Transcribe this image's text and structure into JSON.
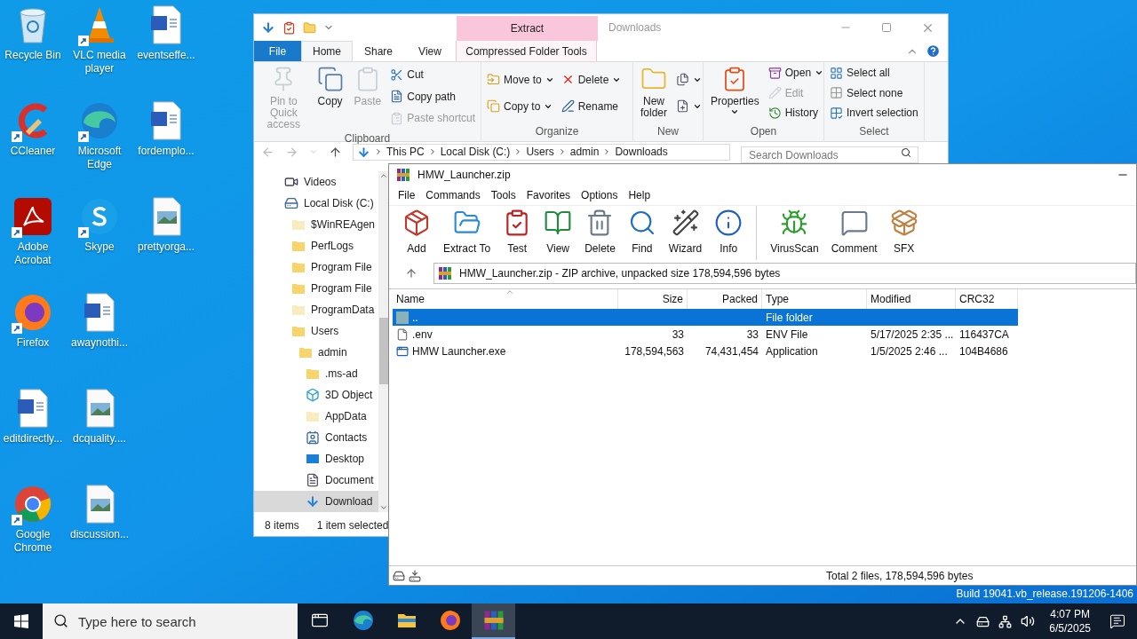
{
  "desktop_icons": [
    {
      "label": "Recycle Bin",
      "kind": "recycle",
      "shortcut": false
    },
    {
      "label": "CCleaner",
      "kind": "ccleaner",
      "shortcut": true
    },
    {
      "label": "Adobe Acrobat",
      "kind": "acrobat",
      "shortcut": true
    },
    {
      "label": "Firefox",
      "kind": "firefox",
      "shortcut": true
    },
    {
      "label": "editdirectly...",
      "kind": "word",
      "shortcut": false
    },
    {
      "label": "Google Chrome",
      "kind": "chrome",
      "shortcut": true
    },
    {
      "label": "VLC media player",
      "kind": "vlc",
      "shortcut": true
    },
    {
      "label": "Microsoft Edge",
      "kind": "edge",
      "shortcut": true
    },
    {
      "label": "Skype",
      "kind": "skype",
      "shortcut": true
    },
    {
      "label": "awaynothi...",
      "kind": "word",
      "shortcut": false
    },
    {
      "label": "dcquality....",
      "kind": "image",
      "shortcut": false
    },
    {
      "label": "discussion...",
      "kind": "image",
      "shortcut": false
    },
    {
      "label": "eventseffe...",
      "kind": "word",
      "shortcut": false
    },
    {
      "label": "fordemplo...",
      "kind": "word",
      "shortcut": false
    },
    {
      "label": "prettyorga...",
      "kind": "image",
      "shortcut": false
    }
  ],
  "explorer": {
    "title": "Downloads",
    "context_header": "Extract",
    "tabs": [
      {
        "label": "File",
        "kind": "file",
        "selected": false
      },
      {
        "label": "Home",
        "kind": "tab",
        "selected": true
      },
      {
        "label": "Share",
        "kind": "tab",
        "selected": false
      },
      {
        "label": "View",
        "kind": "tab",
        "selected": false
      },
      {
        "label": "Compressed Folder Tools",
        "kind": "context",
        "selected": false
      }
    ],
    "groups": [
      {
        "label": "Clipboard",
        "columns": [
          [
            {
              "kind": "large",
              "label": "Pin to Quick access",
              "disabled": true,
              "dropdown": false
            }
          ],
          [
            {
              "kind": "large",
              "label": "Copy",
              "disabled": false,
              "dropdown": false
            }
          ],
          [
            {
              "kind": "large",
              "label": "Paste",
              "disabled": true,
              "dropdown": false
            }
          ],
          [
            {
              "kind": "small",
              "label": "Cut",
              "disabled": false,
              "dropdown": false
            },
            {
              "kind": "small",
              "label": "Copy path",
              "disabled": false,
              "dropdown": false
            },
            {
              "kind": "small",
              "label": "Paste shortcut",
              "disabled": true,
              "dropdown": false
            }
          ]
        ]
      },
      {
        "label": "Organize",
        "columns": [
          [
            {
              "kind": "small",
              "label": "Move to",
              "disabled": false,
              "dropdown": true
            },
            {
              "kind": "small",
              "label": "Copy to",
              "disabled": false,
              "dropdown": true
            }
          ],
          [
            {
              "kind": "small",
              "label": "Delete",
              "disabled": false,
              "dropdown": true
            },
            {
              "kind": "small",
              "label": "Rename",
              "disabled": false,
              "dropdown": false
            }
          ]
        ]
      },
      {
        "label": "New",
        "columns": [
          [
            {
              "kind": "large",
              "label": "New folder",
              "disabled": false,
              "dropdown": false
            }
          ],
          [
            {
              "kind": "small",
              "disabled": false,
              "dropdown": true
            },
            {
              "kind": "small",
              "disabled": false,
              "dropdown": true
            }
          ]
        ]
      },
      {
        "label": "Open",
        "columns": [
          [
            {
              "kind": "large",
              "label": "Properties",
              "disabled": false,
              "dropdown": true
            }
          ],
          [
            {
              "kind": "small",
              "label": "Open",
              "disabled": false,
              "dropdown": true
            },
            {
              "kind": "small",
              "label": "Edit",
              "disabled": true,
              "dropdown": false
            },
            {
              "kind": "small",
              "label": "History",
              "disabled": false,
              "dropdown": false
            }
          ]
        ]
      },
      {
        "label": "Select",
        "columns": [
          [
            {
              "kind": "small",
              "label": "Select all",
              "disabled": false,
              "dropdown": false
            },
            {
              "kind": "small",
              "label": "Select none",
              "disabled": false,
              "dropdown": false
            },
            {
              "kind": "small",
              "label": "Invert selection",
              "disabled": false,
              "dropdown": false
            }
          ]
        ]
      }
    ],
    "address": [
      "This PC",
      "Local Disk (C:)",
      "Users",
      "admin",
      "Downloads"
    ],
    "search": {
      "placeholder": "Search Downloads"
    },
    "tree": [
      {
        "label": "Videos",
        "kind": "videos",
        "selected": false
      },
      {
        "label": "Local Disk (C:)",
        "kind": "drive",
        "selected": false,
        "children": [
          {
            "label": "$WinREAgen",
            "kind": "pale",
            "selected": false
          },
          {
            "label": "PerfLogs",
            "kind": "folder",
            "selected": false
          },
          {
            "label": "Program File",
            "kind": "folder",
            "selected": false
          },
          {
            "label": "Program File",
            "kind": "folder",
            "selected": false
          },
          {
            "label": "ProgramData",
            "kind": "pale",
            "selected": false
          },
          {
            "label": "Users",
            "kind": "folder",
            "selected": false,
            "children": [
              {
                "label": "admin",
                "kind": "folder",
                "selected": false,
                "children": [
                  {
                    "label": ".ms-ad",
                    "kind": "folder",
                    "selected": false
                  },
                  {
                    "label": "3D Object",
                    "kind": "cube",
                    "selected": false
                  },
                  {
                    "label": "AppData",
                    "kind": "pale",
                    "selected": false
                  },
                  {
                    "label": "Contacts",
                    "kind": "contacts",
                    "selected": false
                  },
                  {
                    "label": "Desktop",
                    "kind": "desktop",
                    "selected": false
                  },
                  {
                    "label": "Document",
                    "kind": "document",
                    "selected": false
                  },
                  {
                    "label": "Download",
                    "kind": "download",
                    "selected": true
                  }
                ]
              }
            ]
          }
        ]
      }
    ],
    "status": [
      "8 items",
      "1 item selected"
    ]
  },
  "winrar": {
    "title": "HMW_Launcher.zip",
    "menu": [
      "File",
      "Commands",
      "Tools",
      "Favorites",
      "Options",
      "Help"
    ],
    "toolbar_groups": [
      {
        "buttons": [
          "Add",
          "Extract To",
          "Test",
          "View",
          "Delete",
          "Find",
          "Wizard",
          "Info"
        ]
      },
      {
        "buttons": [
          "VirusScan",
          "Comment",
          "SFX"
        ]
      }
    ],
    "path": "HMW_Launcher.zip - ZIP archive, unpacked size 178,594,596 bytes",
    "columns": [
      {
        "label": "Name",
        "sorted": true
      },
      {
        "label": "Size",
        "sorted": false
      },
      {
        "label": "Packed",
        "sorted": false
      },
      {
        "label": "Type",
        "sorted": false
      },
      {
        "label": "Modified",
        "sorted": false
      },
      {
        "label": "CRC32",
        "sorted": false
      }
    ],
    "rows": [
      {
        "kind": "up",
        "name": "..",
        "type": "File folder",
        "selected": true
      },
      {
        "kind": "file",
        "name": ".env",
        "size": "33",
        "packed": "33",
        "type": "ENV File",
        "modified": "5/17/2025 2:35 ...",
        "crc32": "116437CA",
        "selected": false
      },
      {
        "kind": "exe",
        "name": "HMW Launcher.exe",
        "size": "178,594,563",
        "packed": "74,431,454",
        "type": "Application",
        "modified": "1/5/2025 2:46 ...",
        "crc32": "104B4686",
        "selected": false
      }
    ],
    "status": "Total 2 files, 178,594,596 bytes"
  },
  "build": "Build 19041.vb_release.191206-1406",
  "taskbar": {
    "search": {
      "placeholder": "Type here to search"
    },
    "apps": [
      {
        "kind": "taskview",
        "selected": false
      },
      {
        "kind": "edge",
        "selected": false
      },
      {
        "kind": "explorer",
        "selected": false
      },
      {
        "kind": "firefox",
        "selected": false
      },
      {
        "kind": "winrar",
        "selected": true
      }
    ],
    "time": "4:07 PM",
    "date": "6/5/2025"
  }
}
